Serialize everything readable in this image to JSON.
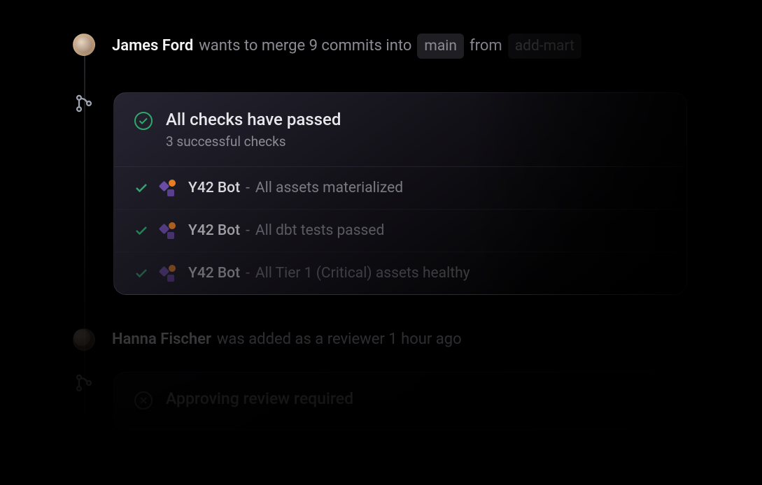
{
  "events": [
    {
      "author": "James Ford",
      "action": "wants to merge 9 commits into",
      "target_branch": "main",
      "from_word": "from",
      "source_branch": "add-mart"
    },
    {
      "author": "Hanna Fischer",
      "action": "was added as a reviewer 1 hour ago"
    }
  ],
  "checks_card": {
    "title": "All checks have passed",
    "subtitle": "3 successful checks",
    "items": [
      {
        "bot": "Y42 Bot",
        "sep": "-",
        "desc": "All assets materialized"
      },
      {
        "bot": "Y42 Bot",
        "sep": "-",
        "desc": "All dbt tests passed"
      },
      {
        "bot": "Y42 Bot",
        "sep": "-",
        "desc": "All Tier 1 (Critical) assets healthy"
      }
    ]
  },
  "review_card": {
    "title": "Approving review required"
  }
}
